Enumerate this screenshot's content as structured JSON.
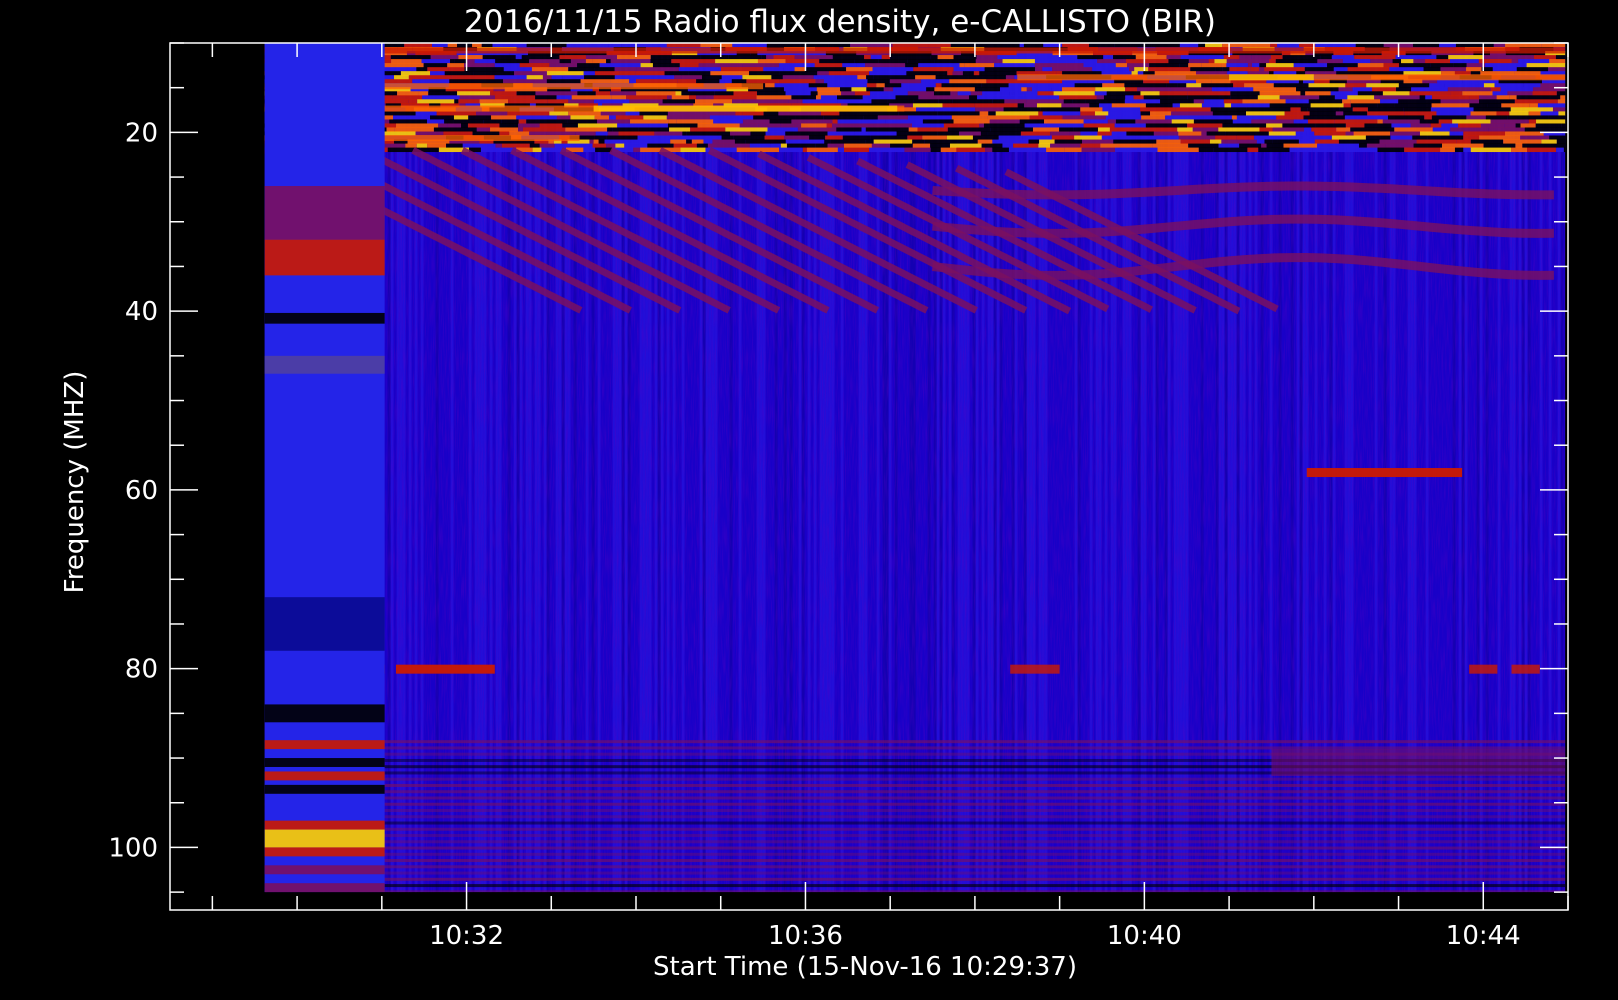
{
  "chart_data": {
    "type": "heatmap",
    "title": "2016/11/15  Radio flux density, e-CALLISTO (BIR)",
    "xlabel": "Start Time (15-Nov-16 10:29:37)",
    "ylabel": "Frequency (MHZ)",
    "x_axis": {
      "unit": "time (HH:MM)",
      "range": [
        "10:28:30",
        "10:45:00"
      ],
      "data_range": [
        "10:29:37",
        "10:44:58"
      ],
      "major_ticks": [
        "10:32",
        "10:36",
        "10:40",
        "10:44"
      ],
      "minor_tick_interval_min": 1
    },
    "y_axis": {
      "unit": "MHz",
      "inverted": true,
      "range": [
        10,
        107
      ],
      "data_range": [
        10,
        105
      ],
      "major_ticks": [
        20,
        40,
        60,
        80,
        100
      ],
      "minor_tick_interval": 5
    },
    "colormap": [
      "#000000",
      "#1a00c8",
      "#2a1ae6",
      "#7a1060",
      "#cc1a00",
      "#ff6400",
      "#ffd200",
      "#ffffa0"
    ],
    "background_level": "blue",
    "features": [
      {
        "name": "RFI bands low frequency",
        "freq_range": [
          10,
          22
        ],
        "time_range": [
          "10:29:37",
          "10:44:58"
        ],
        "intensity": "high"
      },
      {
        "name": "Drifting ionospheric fringes",
        "freq_range": [
          22,
          40
        ],
        "time_range": [
          "10:29:37",
          "10:44:58"
        ],
        "intensity": "medium"
      },
      {
        "name": "Narrowband line 58 MHz",
        "freq": 58,
        "time_range": [
          "10:41:55",
          "10:43:45"
        ],
        "intensity": "medium"
      },
      {
        "name": "Narrowband line 80 MHz",
        "freq": 80,
        "time_range": [
          "10:31:10",
          "10:32:20"
        ],
        "intensity": "medium"
      },
      {
        "name": "Initial calibration block",
        "freq_range": [
          10,
          105
        ],
        "time_range": [
          "10:29:37",
          "10:31:02"
        ],
        "intensity": "mixed"
      },
      {
        "name": "FM band RFI",
        "freq_range": [
          88,
          105
        ],
        "time_range": [
          "10:29:37",
          "10:44:58"
        ],
        "intensity": "low-medium"
      }
    ],
    "grid": false,
    "legend": "none"
  }
}
